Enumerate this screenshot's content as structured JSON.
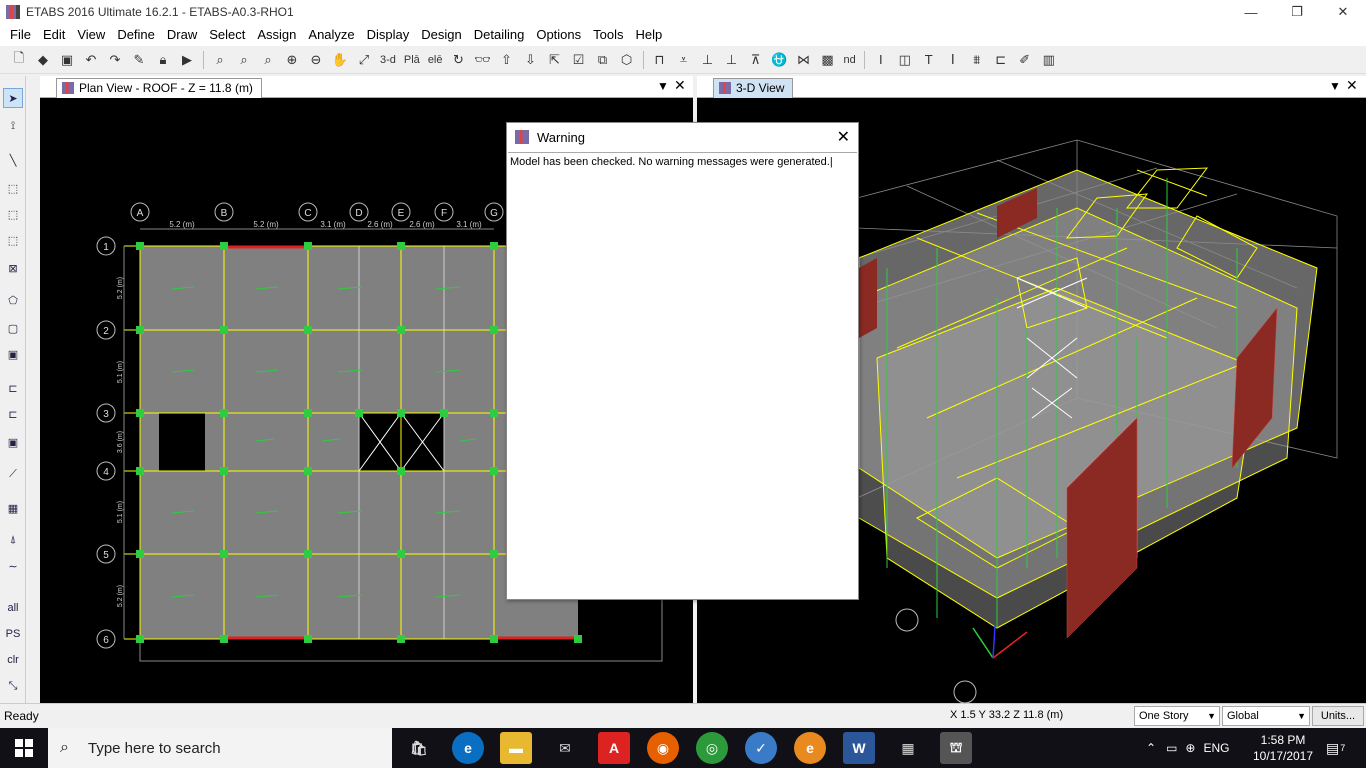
{
  "window": {
    "title": "ETABS 2016 Ultimate 16.2.1 - ETABS-A0.3-RHO1",
    "controls": [
      "—",
      "❐",
      "✕"
    ]
  },
  "menu": [
    "File",
    "Edit",
    "View",
    "Define",
    "Draw",
    "Select",
    "Assign",
    "Analyze",
    "Display",
    "Design",
    "Detailing",
    "Options",
    "Tools",
    "Help"
  ],
  "toolbar": {
    "view_3d_label": "3-d",
    "plan_label": "Plā",
    "elev_label": "elē",
    "nd_label": "nd"
  },
  "plan_view": {
    "tab_label": "Plan View - ROOF - Z = 11.8 (m)",
    "grid_columns": [
      "A",
      "B",
      "C",
      "D",
      "E",
      "F",
      "G"
    ],
    "grid_rows": [
      "1",
      "2",
      "3",
      "4",
      "5",
      "6"
    ],
    "column_spacings": [
      "5.2 (m)",
      "5.2 (m)",
      "3.1 (m)",
      "2.6 (m)",
      "2.6 (m)",
      "3.1 (m)"
    ],
    "row_spacings": [
      "5.2 (m)",
      "5.1 (m)",
      "3.6 (m)",
      "5.1 (m)",
      "5.2 (m)"
    ]
  },
  "view_3d": {
    "tab_label": "3-D View"
  },
  "dialog": {
    "title": "Warning",
    "message": "Model has been checked.  No warning messages were generated.",
    "close": "✕"
  },
  "statusbar": {
    "ready": "Ready",
    "coords": "X 1.5  Y 33.2  Z 11.8 (m)",
    "story_combo": "One Story",
    "coord_combo": "Global",
    "units_button": "Units..."
  },
  "taskbar": {
    "search_placeholder": "Type here to search",
    "language": "ENG",
    "time": "1:58 PM",
    "date": "10/17/2017",
    "notifications": "7"
  },
  "colors": {
    "grid_line": "#ffff00",
    "joint": "#2ecc40",
    "slab": "#808080",
    "background": "#000000",
    "wall": "#8b2a22",
    "accent": "#0078d7"
  }
}
